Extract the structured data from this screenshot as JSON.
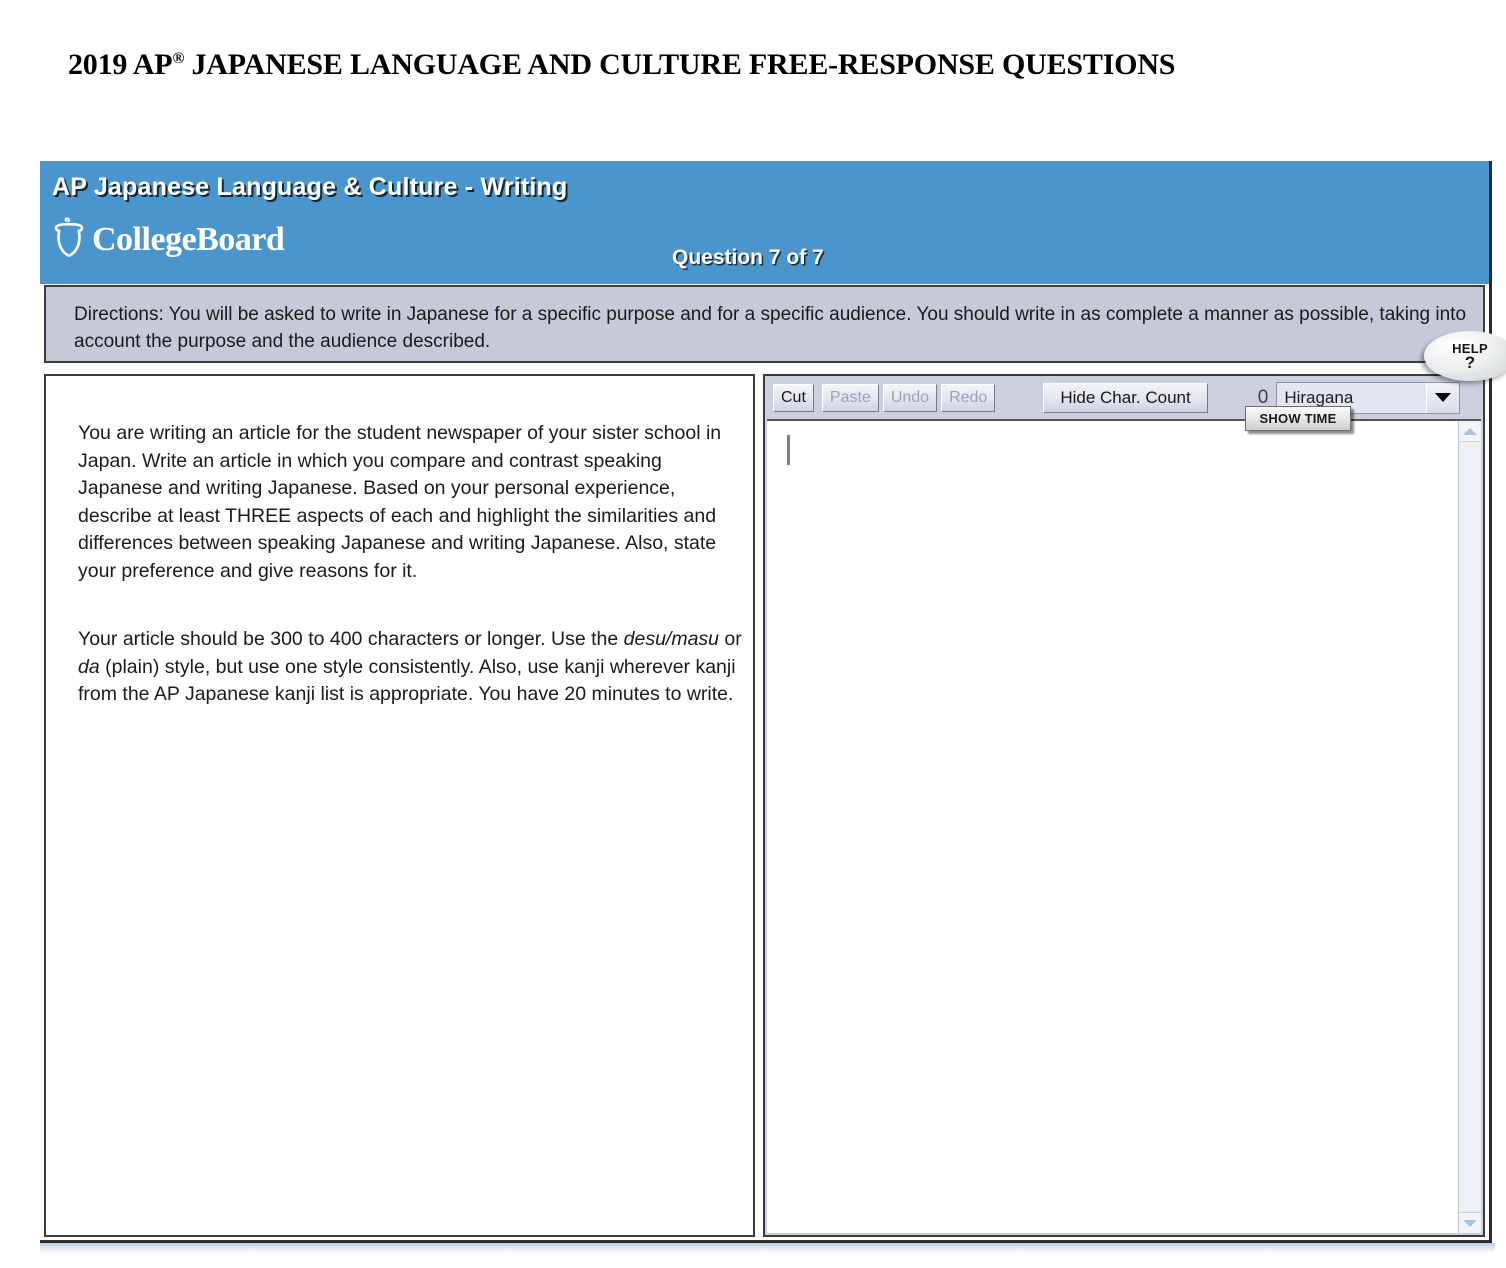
{
  "page": {
    "title_main": "2019 AP",
    "title_sup": "®",
    "title_rest": " JAPANESE LANGUAGE AND CULTURE FREE-RESPONSE QUESTIONS"
  },
  "header": {
    "app_title": "AP Japanese Language & Culture -  Writing",
    "logo_text": "CollegeBoard",
    "logo_icon": "acorn-icon",
    "question_counter": "Question 7 of 7",
    "show_time_label": "SHOW TIME",
    "help_label": "HELP",
    "help_mark": "?",
    "background_color": "#4a96cc"
  },
  "directions": {
    "text": "Directions: You will be asked to write in Japanese for a specific purpose and for a specific audience. You should write in as complete a manner as possible, taking into account the purpose and the audience described.",
    "background_color": "#c5c9d8"
  },
  "prompt": {
    "paragraph_1": "You are writing an article for the student newspaper of your sister school in Japan. Write an article in which you compare and contrast speaking Japanese and writing Japanese. Based on your personal experience, describe at least THREE aspects of each and highlight the similarities and differences between speaking Japanese and writing Japanese. Also, state your preference and give reasons for it.",
    "paragraph_2_part_1": "Your article should be 300 to 400 characters or longer. Use the ",
    "paragraph_2_italic_1": "desu/masu",
    "paragraph_2_part_2": " or ",
    "paragraph_2_italic_2": "da",
    "paragraph_2_part_3": " (plain) style, but use one style consistently. Also, use kanji wherever kanji from the AP Japanese kanji list is appropriate. You have 20 minutes to write."
  },
  "toolbar": {
    "cut_label": "Cut",
    "paste_label": "Paste",
    "undo_label": "Undo",
    "redo_label": "Redo",
    "hide_char_count_label": "Hide Char. Count",
    "char_count": "0",
    "input_mode_value": "Hiragana",
    "dropdown_icon": "chevron-down-icon",
    "background_color": "#ccd0de"
  },
  "answer": {
    "value": "",
    "scroll_up_icon": "triangle-up-icon",
    "scroll_down_icon": "triangle-down-icon"
  }
}
